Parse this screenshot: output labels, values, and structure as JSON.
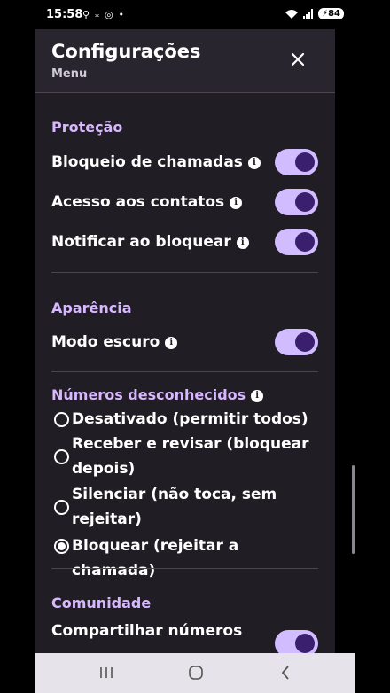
{
  "status_bar": {
    "time": "15:58",
    "battery": "84"
  },
  "header": {
    "title": "Configurações",
    "subtitle": "Menu"
  },
  "protection": {
    "title": "Proteção",
    "items": [
      {
        "label": "Bloqueio de chamadas",
        "enabled": true
      },
      {
        "label": "Acesso aos contatos",
        "enabled": true
      },
      {
        "label": "Notificar ao bloquear",
        "enabled": true
      }
    ]
  },
  "appearance": {
    "title": "Aparência",
    "items": [
      {
        "label": "Modo escuro",
        "enabled": true
      }
    ]
  },
  "unknown_numbers": {
    "title": "Números desconhecidos",
    "options": [
      {
        "label": "Desativado (permitir todos)",
        "selected": false
      },
      {
        "label": "Receber e revisar (bloquear depois)",
        "selected": false
      },
      {
        "label": "Silenciar (não toca, sem rejeitar)",
        "selected": false
      },
      {
        "label": "Bloquear (rejeitar a chamada)",
        "selected": true
      }
    ]
  },
  "community": {
    "title": "Comunidade",
    "items": [
      {
        "label": "Compartilhar números",
        "enabled": true
      }
    ]
  },
  "colors": {
    "accent": "#d7b8ff",
    "toggle_track": "#d0bcff",
    "toggle_knob": "#3a1f6e",
    "background": "#211d25"
  }
}
